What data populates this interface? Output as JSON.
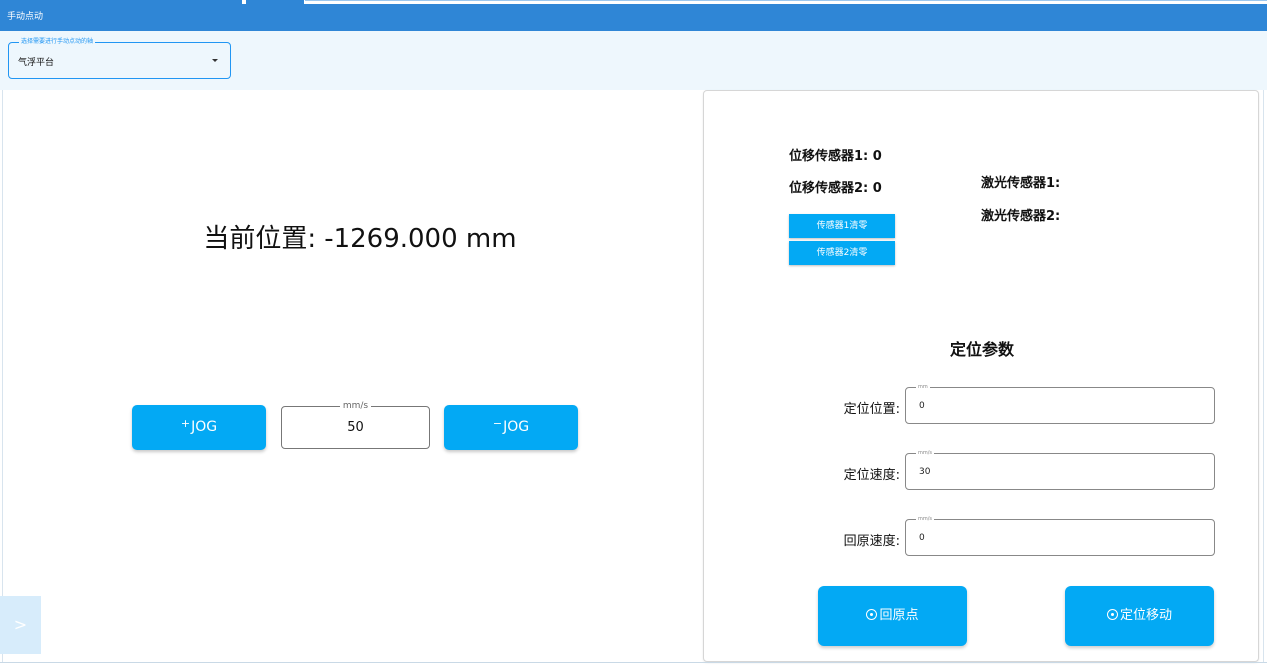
{
  "header": {
    "title": "手动点动"
  },
  "axis_select": {
    "legend": "选择需要进行手动点动的轴",
    "value": "气浮平台"
  },
  "position": {
    "label": "当前位置:",
    "value": "-1269.000",
    "unit": "mm"
  },
  "jog": {
    "plus_sign": "+",
    "plus_label": "JOG",
    "minus_sign": "−",
    "minus_label": "JOG",
    "speed_unit": "mm/s",
    "speed_value": "50"
  },
  "side_tab": {
    "label": ">"
  },
  "sensors": {
    "disp1": "位移传感器1: 0",
    "disp2": "位移传感器2: 0",
    "laser1": "激光传感器1:",
    "laser2": "激光传感器2:",
    "zero1_label": "传感器1清零",
    "zero2_label": "传感器2清零"
  },
  "positioning": {
    "title": "定位参数",
    "fields": [
      {
        "label": "定位位置:",
        "unit": "mm",
        "value": "0"
      },
      {
        "label": "定位速度:",
        "unit": "mm/s",
        "value": "30"
      },
      {
        "label": "回原速度:",
        "unit": "mm/s",
        "value": "0"
      }
    ],
    "home_label": "回原点",
    "move_label": "定位移动"
  },
  "colors": {
    "header": "#2f86d6",
    "accent": "#03a9f4",
    "panel_bg": "#eef7fd"
  }
}
